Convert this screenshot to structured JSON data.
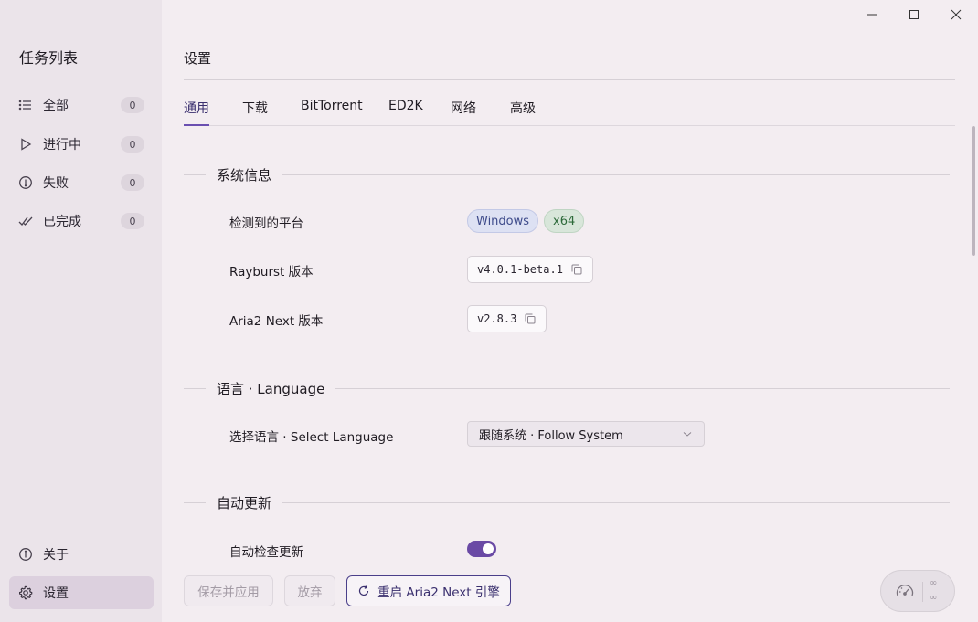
{
  "sidebar": {
    "title": "任务列表",
    "items": [
      {
        "label": "全部",
        "count": "0",
        "icon": "list-icon"
      },
      {
        "label": "进行中",
        "count": "0",
        "icon": "play-icon"
      },
      {
        "label": "失败",
        "count": "0",
        "icon": "alert-circle-icon"
      },
      {
        "label": "已完成",
        "count": "0",
        "icon": "double-check-icon"
      }
    ],
    "bottom": [
      {
        "label": "关于",
        "icon": "info-icon"
      },
      {
        "label": "设置",
        "icon": "gear-icon"
      }
    ]
  },
  "header": {
    "title": "设置"
  },
  "tabs": [
    {
      "label": "通用",
      "active": true
    },
    {
      "label": "下载"
    },
    {
      "label": "BitTorrent"
    },
    {
      "label": "ED2K"
    },
    {
      "label": "网络"
    },
    {
      "label": "高级"
    }
  ],
  "system_info": {
    "heading": "系统信息",
    "platform_label": "检测到的平台",
    "platform_os": "Windows",
    "platform_arch": "x64",
    "rayburst_label": "Rayburst 版本",
    "rayburst_version": "v4.0.1-beta.1",
    "aria2_label": "Aria2 Next 版本",
    "aria2_version": "v2.8.3"
  },
  "language": {
    "heading": "语言 · Language",
    "select_label": "选择语言 · Select Language",
    "selected": "跟随系统 · Follow System"
  },
  "auto_update": {
    "heading": "自动更新",
    "check_label": "自动检查更新",
    "enabled": true
  },
  "footer": {
    "save_label": "保存并应用",
    "discard_label": "放弃",
    "restart_label": "重启 Aria2 Next 引擎",
    "speed_top": "∞",
    "speed_bottom": "∞"
  },
  "colors": {
    "accent": "#6a4aa5",
    "sidebar_bg": "#ebe4ea",
    "page_bg": "#f3edf1"
  }
}
